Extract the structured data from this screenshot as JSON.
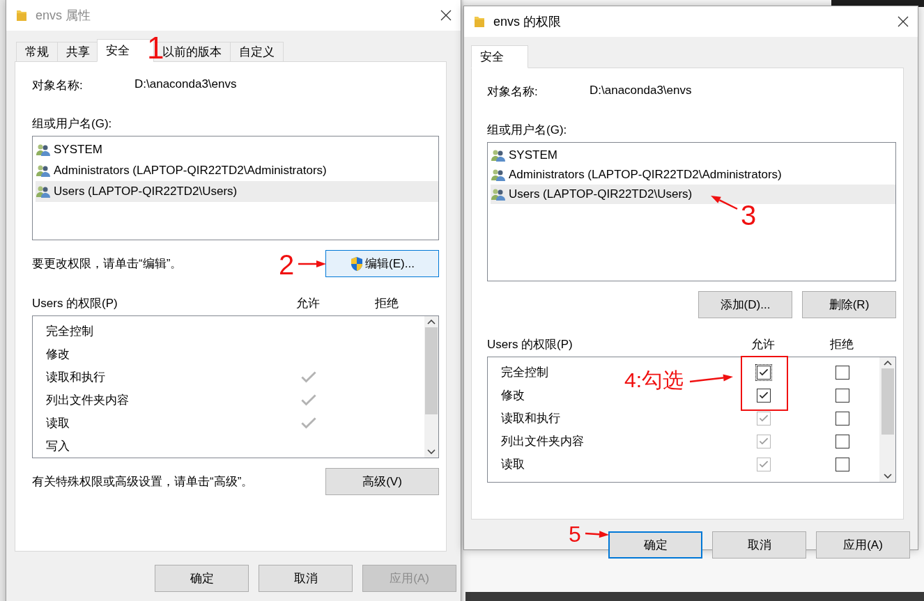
{
  "properties_dialog": {
    "title": "envs 属性",
    "active": false,
    "tabs": [
      {
        "label": "常规",
        "selected": false
      },
      {
        "label": "共享",
        "selected": false
      },
      {
        "label": "安全",
        "selected": true
      },
      {
        "label": "以前的版本",
        "selected": false
      },
      {
        "label": "自定义",
        "selected": false
      }
    ],
    "object_name_label": "对象名称:",
    "object_name": "D:\\anaconda3\\envs",
    "groups_label": "组或用户名(G):",
    "groups": [
      {
        "name": "SYSTEM",
        "selected": false
      },
      {
        "name": "Administrators (LAPTOP-QIR22TD2\\Administrators)",
        "selected": false
      },
      {
        "name": "Users (LAPTOP-QIR22TD2\\Users)",
        "selected": true
      }
    ],
    "edit_hint": "要更改权限，请单击“编辑”。",
    "edit_button": "编辑(E)...",
    "permissions_label": "Users 的权限(P)",
    "allow_header": "允许",
    "deny_header": "拒绝",
    "permissions": [
      {
        "name": "完全控制",
        "allowed": false
      },
      {
        "name": "修改",
        "allowed": false
      },
      {
        "name": "读取和执行",
        "allowed": true
      },
      {
        "name": "列出文件夹内容",
        "allowed": true
      },
      {
        "name": "读取",
        "allowed": true
      },
      {
        "name": "写入",
        "allowed": false
      }
    ],
    "advanced_hint": "有关特殊权限或高级设置，请单击“高级”。",
    "advanced_button": "高级(V)",
    "buttons": [
      {
        "label": "确定",
        "disabled": false,
        "default": false
      },
      {
        "label": "取消",
        "disabled": false,
        "default": false
      },
      {
        "label": "应用(A)",
        "disabled": true,
        "default": false
      }
    ]
  },
  "permissions_dialog": {
    "title": "envs 的权限",
    "active": true,
    "tabs": [
      {
        "label": "安全",
        "selected": true
      }
    ],
    "object_name_label": "对象名称:",
    "object_name": "D:\\anaconda3\\envs",
    "groups_label": "组或用户名(G):",
    "groups": [
      {
        "name": "SYSTEM",
        "selected": false
      },
      {
        "name": "Administrators (LAPTOP-QIR22TD2\\Administrators)",
        "selected": false
      },
      {
        "name": "Users (LAPTOP-QIR22TD2\\Users)",
        "selected": true
      }
    ],
    "group_buttons": [
      "添加(D)...",
      "删除(R)"
    ],
    "permissions_label": "Users 的权限(P)",
    "allow_header": "允许",
    "deny_header": "拒绝",
    "permissions": [
      {
        "name": "完全控制",
        "allow": true,
        "allow_disabled": false,
        "deny": false
      },
      {
        "name": "修改",
        "allow": true,
        "allow_disabled": false,
        "deny": false
      },
      {
        "name": "读取和执行",
        "allow": true,
        "allow_disabled": true,
        "deny": false
      },
      {
        "name": "列出文件夹内容",
        "allow": true,
        "allow_disabled": true,
        "deny": false
      },
      {
        "name": "读取",
        "allow": true,
        "allow_disabled": true,
        "deny": false
      }
    ],
    "buttons": [
      {
        "label": "确定",
        "disabled": false,
        "default": true
      },
      {
        "label": "取消",
        "disabled": false,
        "default": false
      },
      {
        "label": "应用(A)",
        "disabled": false,
        "default": false
      }
    ]
  },
  "annotations": [
    {
      "text": "1",
      "arrow": false
    },
    {
      "text": "2",
      "arrow": true
    },
    {
      "text": "3",
      "arrow": true
    },
    {
      "text": "4:勾选",
      "arrow": true
    },
    {
      "text": "5",
      "arrow": true
    }
  ],
  "highlight_box": true
}
